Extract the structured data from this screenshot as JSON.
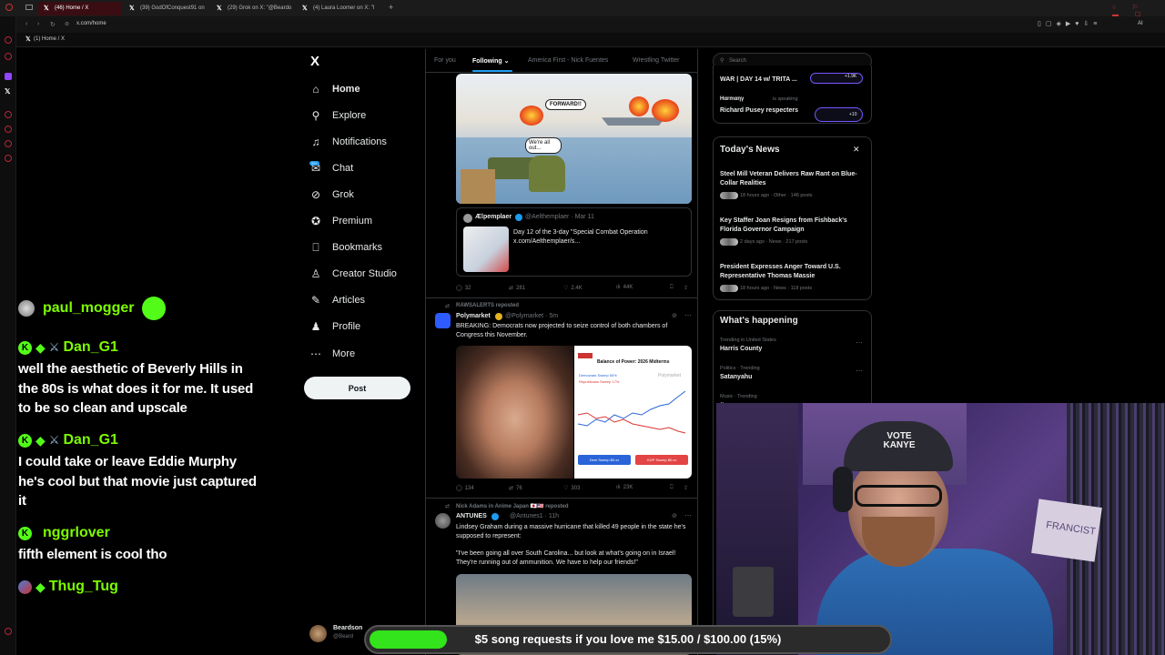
{
  "browser": {
    "tabs": [
      {
        "title": "(46) Home / X",
        "active": true
      },
      {
        "title": "(39) GodOfConquest91 on",
        "active": false
      },
      {
        "title": "(29) Grok on X: \"@Beardo",
        "active": false
      },
      {
        "title": "(4) Laura Loomer on X: \"I",
        "active": false
      }
    ],
    "new_tab": "+",
    "url": "x.com/home",
    "bookmark": "(1) Home / X",
    "ai_label": "AI"
  },
  "chat": [
    {
      "user": "paul_mogger",
      "text": ""
    },
    {
      "user": "Dan_G1",
      "text": "well the aesthetic of Beverly Hills in the 80s is what does it for me. It used to be so clean and upscale"
    },
    {
      "user": "Dan_G1",
      "text": "I could take or leave Eddie Murphy he's cool but that movie just captured it"
    },
    {
      "user": "nggrlover",
      "text": "fifth element is cool tho"
    },
    {
      "user": "Thug_Tug",
      "text": ""
    }
  ],
  "nav": {
    "logo": "X",
    "items": [
      "Home",
      "Explore",
      "Notifications",
      "Chat",
      "Grok",
      "Premium",
      "Bookmarks",
      "Creator Studio",
      "Articles",
      "Profile",
      "More"
    ],
    "chat_badge": "20+",
    "post_label": "Post",
    "account_name": "Beardson",
    "account_handle": "@Beard"
  },
  "feed": {
    "tabs": [
      "For you",
      "Following",
      "America First - Nick Fuentes",
      "Wrestling Twitter"
    ],
    "active_tab": "Following",
    "comic_bubbles": [
      "FORWARD!!",
      "We're all out..."
    ],
    "quote": {
      "name": "Ælpemplaer",
      "handle": "@Aelthemplaer · Mar 11",
      "text": "Day 12 of the 3-day \"Special Combat Operation x.com/Aelthemplaer/s..."
    },
    "tweet1_actions": {
      "replies": "32",
      "reposts": "281",
      "likes": "2.4K",
      "views": "44K"
    },
    "tweet2": {
      "repost_by": "RAWSALERTS reposted",
      "name": "Polymarket",
      "handle": "@Polymarket · 5m",
      "text": "BREAKING: Democrats now projected to seize control of both chambers of Congress this November.",
      "card_title": "Balance of Power: 2026 Midterms",
      "card_brand": "Polymarket",
      "card_legend": [
        "Democrats Sweep 50%",
        "Republicans Sweep 17%"
      ],
      "card_buttons": [
        "Dem Sweep $0.xx",
        "GOP Sweep $0.xx"
      ],
      "actions": {
        "replies": "134",
        "reposts": "76",
        "likes": "303",
        "views": "23K"
      }
    },
    "tweet3": {
      "repost_by": "Nick Adams in Anime Japan 🇯🇵🇺🇸 reposted",
      "name": "ANTUNES",
      "handle": "@Antunes1 · 11h",
      "text1": "Lindsey Graham during a massive hurricane that killed 49 people in the state he's supposed to represent:",
      "text2": "\"I've been going all over South Carolina... but look at what's going on in Israel! They're running out of ammunition. We have to help our friends!\""
    }
  },
  "right": {
    "search_placeholder": "Search",
    "spaces": [
      {
        "title": "WAR | DAY 14 w/ TRITA ...",
        "count": "+1.9K"
      },
      {
        "host": "Hαrmαηγ",
        "status": "is speaking",
        "title": "Richard Pusey respecters",
        "count": "+10"
      }
    ],
    "news_header": "Today's News",
    "news": [
      {
        "title": "Steel Mill Veteran Delivers Raw Rant on Blue-Collar Realities",
        "meta": "18 hours ago · Other · 148 posts"
      },
      {
        "title": "Key Staffer Joan Resigns from Fishback's Florida Governor Campaign",
        "meta": "2 days ago · News · 217 posts"
      },
      {
        "title": "President Expresses Anger Toward U.S. Representative Thomas Massie",
        "meta": "18 hours ago · News · 118 posts"
      }
    ],
    "happening_header": "What's happening",
    "trends": [
      {
        "cat": "Trending in United States",
        "title": "Harris County"
      },
      {
        "cat": "Politics · Trending",
        "title": "Satanyahu"
      },
      {
        "cat": "Music · Trending",
        "title": "#"
      }
    ]
  },
  "stream": {
    "song_bar_text": "$5 song requests if you love me $15.00 / $100.00 (15%)",
    "song_progress": 0.15,
    "hat_text": "VOTE KANYE",
    "sign_text": "FRANCIST"
  }
}
